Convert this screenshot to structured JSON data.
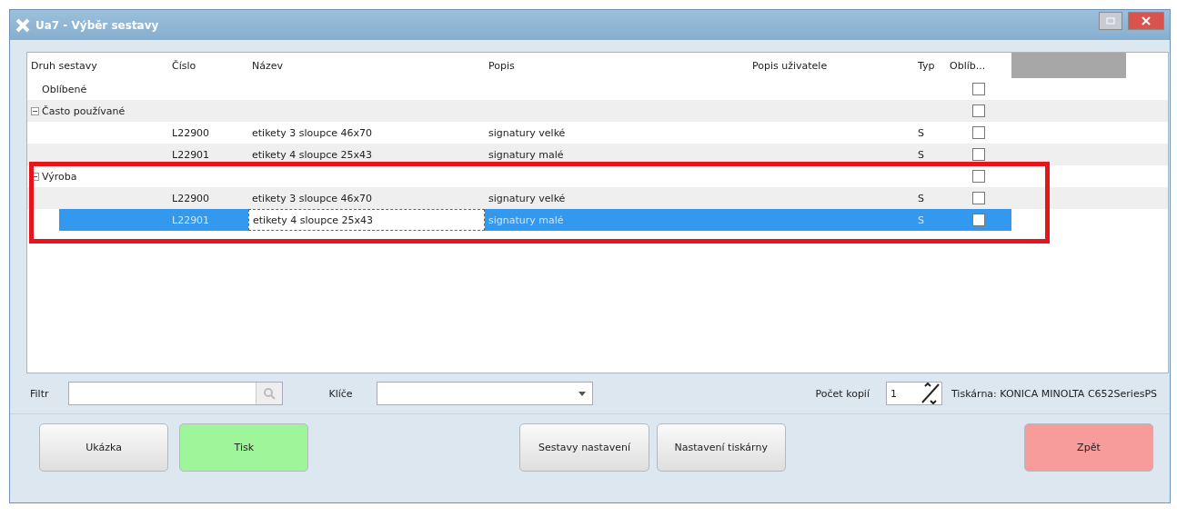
{
  "window": {
    "title": "Ua7 - Výběr sestavy"
  },
  "table": {
    "columns": [
      "Druh sestavy",
      "Číslo",
      "Název",
      "Popis",
      "Popis uživatele",
      "Typ",
      "Oblíb..."
    ],
    "rows": [
      {
        "label": "Oblíbené",
        "favorite": false,
        "selected": false
      },
      {
        "label": "Často používané",
        "expanded": true,
        "favorite": false,
        "selected": false,
        "children": [
          {
            "cislo": "L22900",
            "nazev": "etikety 3 sloupce 46x70",
            "popis": "signatury velké",
            "typ": "S",
            "favorite": false,
            "selected": false
          },
          {
            "cislo": "L22901",
            "nazev": "etikety 4 sloupce 25x43",
            "popis": "signatury malé",
            "typ": "S",
            "favorite": false,
            "selected": false
          }
        ]
      },
      {
        "label": "Výroba",
        "expanded": true,
        "favorite": false,
        "selected": false,
        "highlighted": true,
        "children": [
          {
            "cislo": "L22900",
            "nazev": "etikety 3 sloupce 46x70",
            "popis": "signatury velké",
            "typ": "S",
            "favorite": false,
            "selected": false
          },
          {
            "cislo": "L22901",
            "nazev": "etikety 4 sloupce 25x43",
            "popis": "signatury malé",
            "typ": "S",
            "favorite": false,
            "selected": true
          }
        ]
      }
    ]
  },
  "filter": {
    "label": "Filtr",
    "keys_label": "Klíče",
    "copies_label": "Počet kopií",
    "copies": "1",
    "printer": "Tiskárna: KONICA MINOLTA C652SeriesPS"
  },
  "buttons": [
    {
      "label": "Ukázka",
      "kind": "plain"
    },
    {
      "label": "Tisk",
      "kind": "confirm"
    },
    {
      "label": "Sestavy nastavení",
      "kind": "plain"
    },
    {
      "label": "Nastavení tiskárny",
      "kind": "plain"
    },
    {
      "label": "Zpět",
      "kind": "cancel"
    }
  ]
}
